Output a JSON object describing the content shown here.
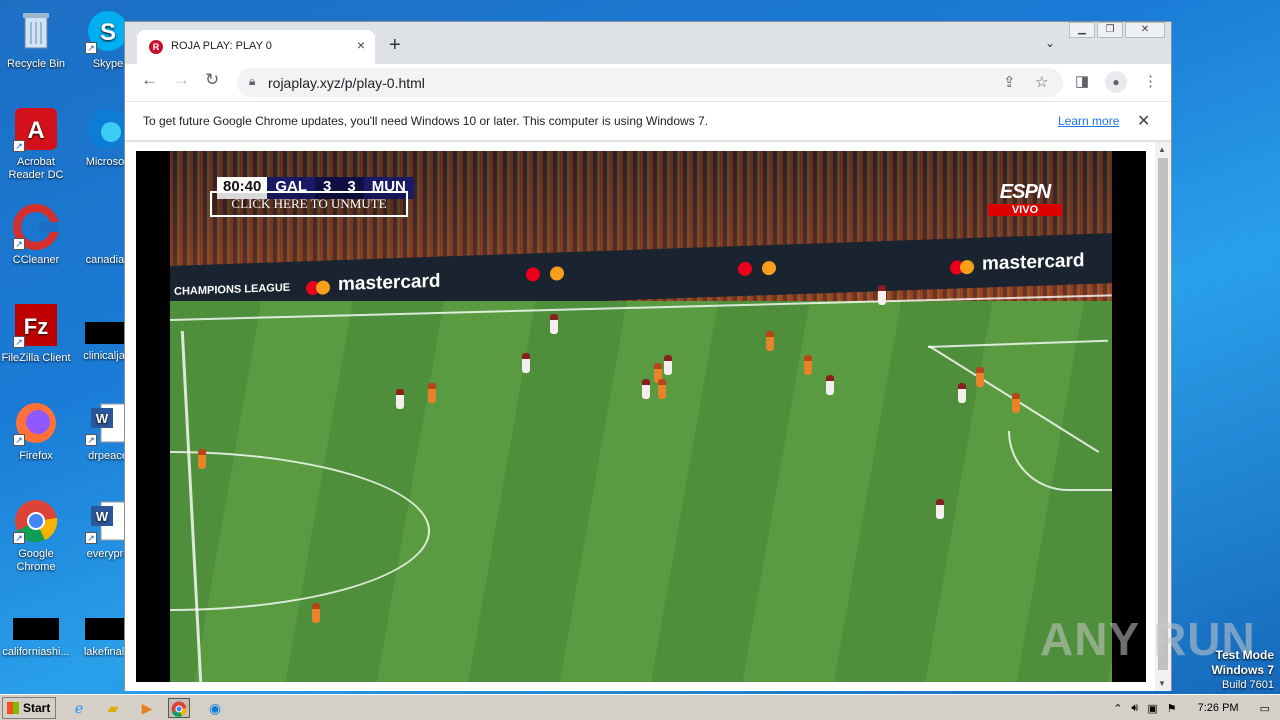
{
  "desktop": {
    "icons_left": [
      {
        "label": "Recycle Bin",
        "icon": "recycle-bin-icon"
      },
      {
        "label": "Acrobat Reader DC",
        "icon": "acrobat-icon"
      },
      {
        "label": "CCleaner",
        "icon": "ccleaner-icon"
      },
      {
        "label": "FileZilla Client",
        "icon": "filezilla-icon"
      },
      {
        "label": "Firefox",
        "icon": "firefox-icon"
      },
      {
        "label": "Google Chrome",
        "icon": "chrome-icon"
      },
      {
        "label": "californiashi...",
        "icon": "file-icon"
      }
    ],
    "icons_right": [
      {
        "label": "Skype",
        "icon": "skype-icon"
      },
      {
        "label": "Microsoft",
        "icon": "edge-icon"
      },
      {
        "label": "canadian",
        "icon": "file-icon"
      },
      {
        "label": "clinicaljacl",
        "icon": "file-icon"
      },
      {
        "label": "drpeace",
        "icon": "word-icon"
      },
      {
        "label": "everypre",
        "icon": "word-icon"
      },
      {
        "label": "lakefinally",
        "icon": "file-icon"
      }
    ]
  },
  "browser": {
    "tab_title": "ROJA PLAY: PLAY 0",
    "url": "rojaplay.xyz/p/play-0.html",
    "infobar_text": "To get future Google Chrome updates, you'll need Windows 10 or later. This computer is using Windows 7.",
    "learn_more": "Learn more"
  },
  "video": {
    "clock": "80:40",
    "home_team": "GAL",
    "home_score": "3",
    "away_score": "3",
    "away_team": "MUN",
    "unmute_label": "CLICK HERE TO UNMUTE",
    "broadcaster": "ESPN",
    "live_label": "VIVO",
    "ad_text_1": "mastercard",
    "ad_text_2": "mastercard",
    "league_text": "CHAMPIONS LEAGUE"
  },
  "overlay": {
    "watermark": "ANY RUN",
    "test_mode": "Test Mode",
    "os_name": "Windows 7",
    "build": "Build 7601"
  },
  "taskbar": {
    "start_label": "Start",
    "time": "7:26 PM"
  }
}
